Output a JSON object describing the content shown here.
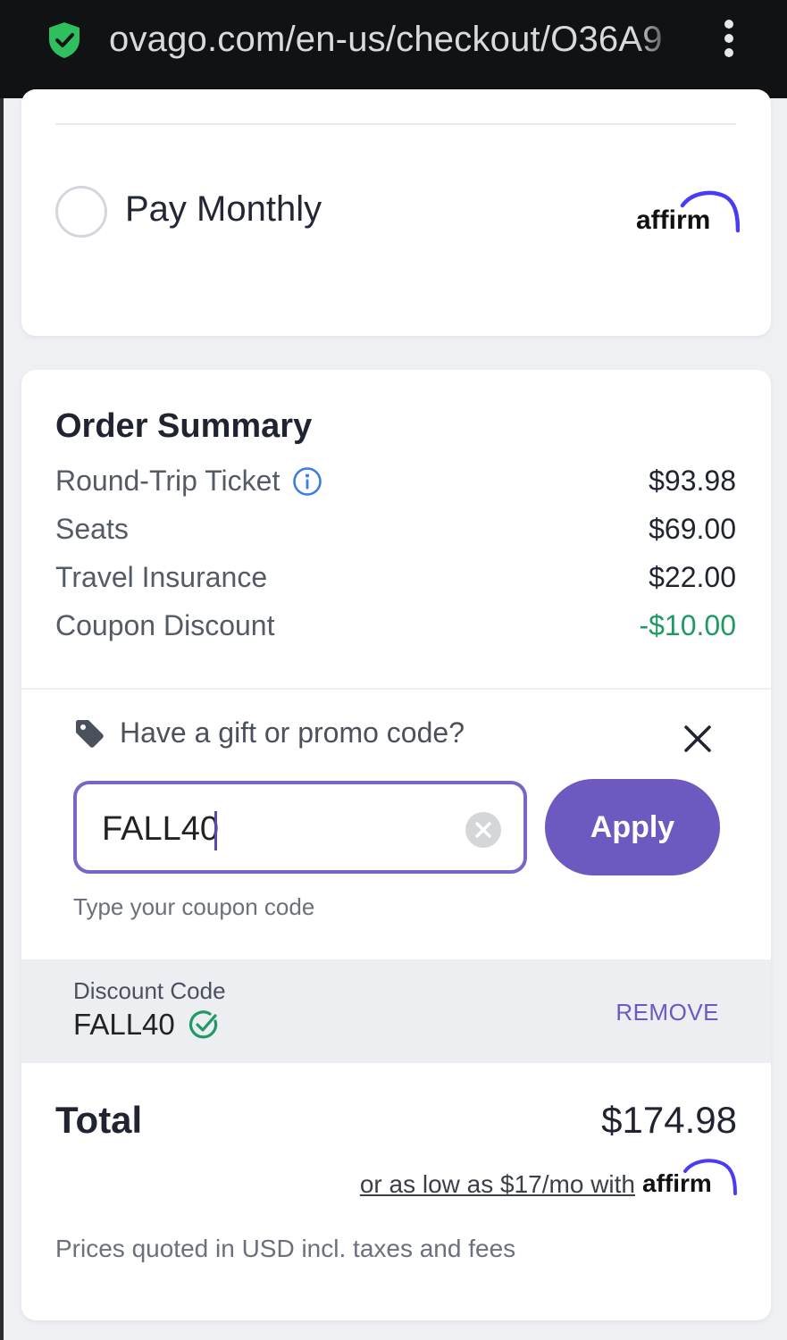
{
  "browser": {
    "url": "ovago.com/en-us/checkout/O36A9"
  },
  "payment": {
    "pay_monthly_label": "Pay Monthly",
    "provider_logo_text": "affirm"
  },
  "order_summary": {
    "title": "Order Summary",
    "items": [
      {
        "label": "Round-Trip Ticket",
        "amount": "$93.98"
      },
      {
        "label": "Seats",
        "amount": "$69.00"
      },
      {
        "label": "Travel Insurance",
        "amount": "$22.00"
      },
      {
        "label": "Coupon Discount",
        "amount": "-$10.00"
      }
    ]
  },
  "promo": {
    "question": "Have a gift or promo code?",
    "input_value": "FALL40",
    "apply_label": "Apply",
    "hint": "Type your coupon code"
  },
  "discount": {
    "label": "Discount Code",
    "code": "FALL40",
    "remove_label": "REMOVE"
  },
  "total": {
    "label": "Total",
    "amount": "$174.98",
    "financing_text": "or as low as $17/mo with",
    "financing_brand": "affirm"
  },
  "footer_note": "Prices quoted in USD incl. taxes and fees",
  "colors": {
    "accent": "#6e59c0",
    "discount_green": "#1f9a64",
    "shield_green": "#2fbf5e"
  }
}
